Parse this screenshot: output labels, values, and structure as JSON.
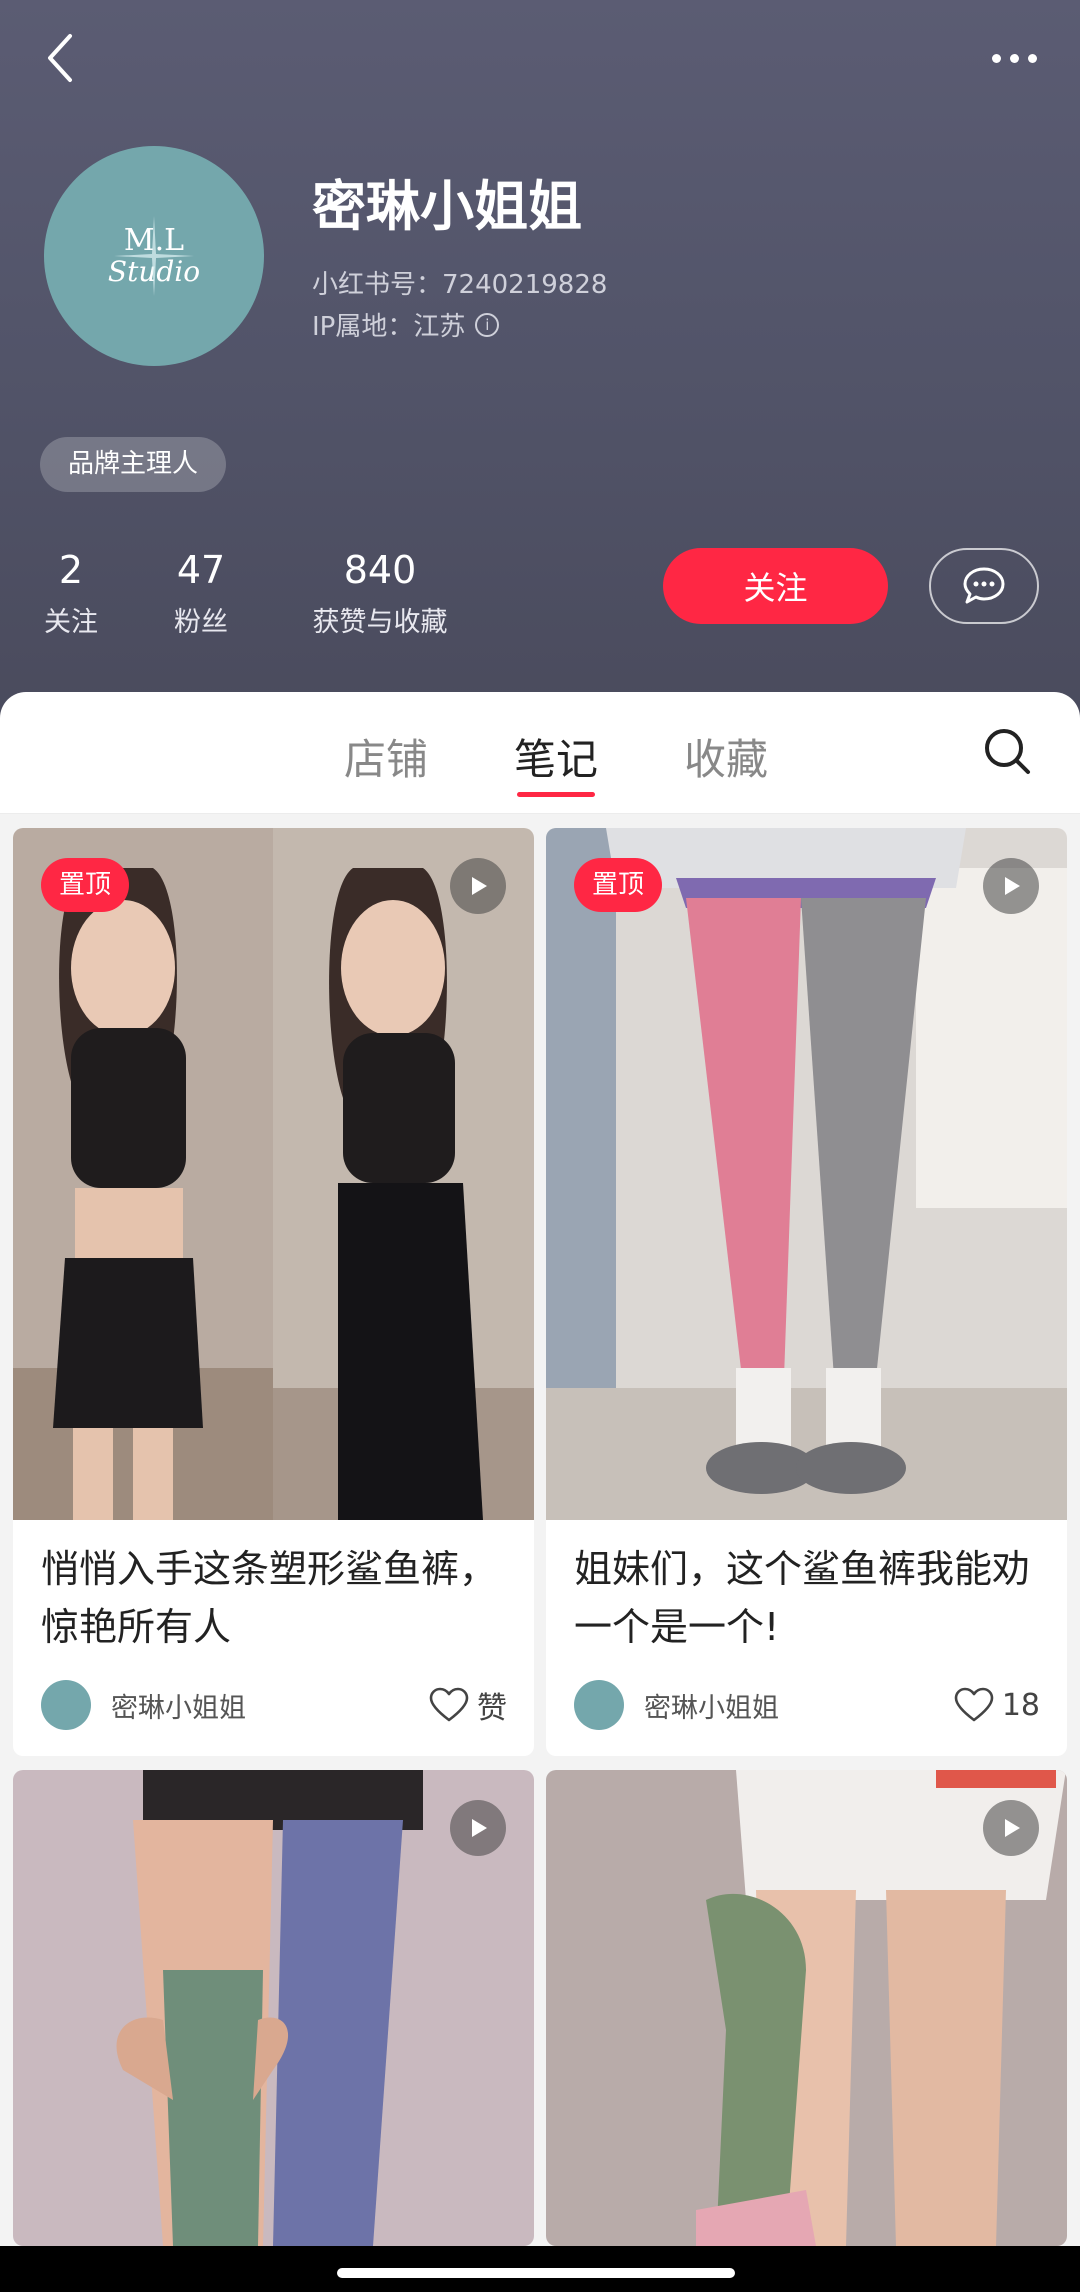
{
  "header": {
    "name": "密琳小姐姐",
    "red_id": "小红书号：7240219828",
    "ip_location": "IP属地：江苏",
    "avatar": {
      "line1": "M.L",
      "line2": "Studio"
    },
    "badge": "品牌主理人"
  },
  "stats": [
    {
      "value": "2",
      "label": "关注"
    },
    {
      "value": "47",
      "label": "粉丝"
    },
    {
      "value": "840",
      "label": "获赞与收藏"
    }
  ],
  "actions": {
    "follow": "关注"
  },
  "tabs": [
    {
      "label": "店铺",
      "active": false
    },
    {
      "label": "笔记",
      "active": true
    },
    {
      "label": "收藏",
      "active": false
    }
  ],
  "notes": [
    {
      "pinned_label": "置顶",
      "title": "悄悄入手这条塑形鲨鱼裤，惊艳所有人",
      "author": "密琳小姐姐",
      "likes": "赞"
    },
    {
      "pinned_label": "置顶",
      "title": "姐妹们，这个鲨鱼裤我能劝一个是一个!",
      "author": "密琳小姐姐",
      "likes": "18"
    }
  ],
  "colors": {
    "accent": "#ff2744",
    "header_bg": "#525469",
    "avatar_bg": "#74a7ac"
  },
  "icons": [
    "back-icon",
    "more-icon",
    "info-icon",
    "message-icon",
    "search-icon",
    "play-icon",
    "heart-icon"
  ]
}
